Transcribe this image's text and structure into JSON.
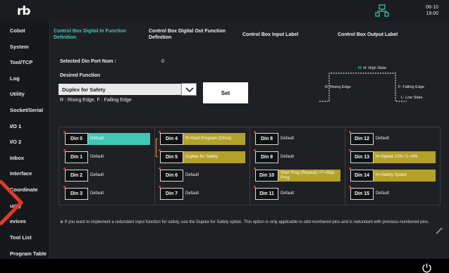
{
  "app": {
    "logo": "rb",
    "date": "06-10",
    "time": "19:00"
  },
  "sidebar": {
    "items": [
      {
        "label": "Cobot"
      },
      {
        "label": "System"
      },
      {
        "label": "Tool/TCP"
      },
      {
        "label": "Log"
      },
      {
        "label": "Utility"
      },
      {
        "label": "Socket/Serial"
      },
      {
        "label": "I/O 1"
      },
      {
        "label": "I/O 2"
      },
      {
        "label": "Inbox"
      },
      {
        "label": "Interface"
      },
      {
        "label": "Coordinate"
      },
      {
        "label": "urity"
      },
      {
        "label": "evices"
      },
      {
        "label": "Tool List"
      },
      {
        "label": "Program Table"
      }
    ]
  },
  "tabs": [
    {
      "label": "Control Box Digital In Function Definition"
    },
    {
      "label": "Control Box Digital Out Function Definition"
    },
    {
      "label": "Control Box Input Label"
    },
    {
      "label": "Control Box Output Label"
    }
  ],
  "form": {
    "selected_label": "Selected Din Port Num :",
    "selected_value": "0",
    "desired_label": "Desired Function",
    "function_value": "Duplex for Safety",
    "set_label": "Set",
    "hint": "R : Rising Edge, F : Falling Edge"
  },
  "legend": {
    "high": "H: High State",
    "rising": "R: Rising Edge",
    "falling": "F: Falling Edge",
    "low": "L: Low State"
  },
  "pins": [
    {
      "name": "Din 0",
      "function": "Default",
      "style": "teal"
    },
    {
      "name": "Din 1",
      "function": "Default",
      "style": "none"
    },
    {
      "name": "Din 2",
      "function": "Default",
      "style": "none"
    },
    {
      "name": "Din 3",
      "function": "Default",
      "style": "none"
    },
    {
      "name": "Din 4",
      "function": "R=Start Program (Once)",
      "style": "yellow"
    },
    {
      "name": "Din 5",
      "function": "Duplex for Safety",
      "style": "yellow"
    },
    {
      "name": "Din 6",
      "function": "Default",
      "style": "none"
    },
    {
      "name": "Din 7",
      "function": "Default",
      "style": "none"
    },
    {
      "name": "Din 8",
      "function": "Default",
      "style": "none"
    },
    {
      "name": "Din 9",
      "function": "Default",
      "style": "none"
    },
    {
      "name": "Din 10",
      "function": "Start Prog (Repeat) / F=Stop Prog",
      "style": "yellow"
    },
    {
      "name": "Din 11",
      "function": "Default",
      "style": "none"
    },
    {
      "name": "Din 12",
      "function": "Default",
      "style": "none"
    },
    {
      "name": "Din 13",
      "function": "H=Speed 10% / L=0%",
      "style": "yellow"
    },
    {
      "name": "Din 14",
      "function": "H=Safety Speed",
      "style": "yellow"
    },
    {
      "name": "Din 15",
      "function": "Default",
      "style": "none"
    }
  ],
  "note": "※ If you want to implement a redundant input function for safety, use the Duplex for Safety option. This option is only applicable to odd-numbered pins and is redundant with previous-numbered pins.",
  "colors": {
    "accent": "#3ec9b5",
    "active_function": "#b3a12b",
    "bracket": "#f2a12a",
    "pin_marker": "#e53935"
  },
  "icons": {
    "network": "network-icon",
    "power": "power-icon",
    "dropdown": "chevron-down-icon"
  }
}
